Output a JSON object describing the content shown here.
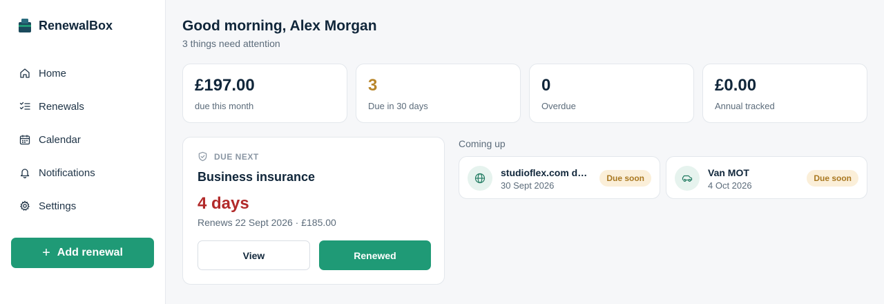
{
  "app": {
    "name": "RenewalBox"
  },
  "sidebar": {
    "items": [
      {
        "label": "Home",
        "icon": "home-icon"
      },
      {
        "label": "Renewals",
        "icon": "checklist-icon"
      },
      {
        "label": "Calendar",
        "icon": "calendar-icon"
      },
      {
        "label": "Notifications",
        "icon": "bell-icon"
      },
      {
        "label": "Settings",
        "icon": "gear-icon"
      }
    ],
    "add_button": {
      "label": "Add renewal",
      "plus": "+"
    }
  },
  "header": {
    "greeting": "Good morning, Alex Morgan",
    "subtitle": "3 things need attention"
  },
  "stats": [
    {
      "value": "£197.00",
      "label": "due this month"
    },
    {
      "value": "3",
      "label": "Due in 30 days",
      "color": "#b8862b"
    },
    {
      "value": "0",
      "label": "Overdue"
    },
    {
      "value": "£0.00",
      "label": "Annual tracked"
    }
  ],
  "due_next": {
    "tag": "DUE NEXT",
    "title": "Business insurance",
    "days": "4 days",
    "renews": "Renews 22 Sept 2026 · £185.00",
    "view_label": "View",
    "renewed_label": "Renewed"
  },
  "coming_up": {
    "title": "Coming up",
    "items": [
      {
        "name": "studioflex.com domain",
        "date": "30 Sept 2026",
        "badge": "Due soon",
        "icon": "globe-icon"
      },
      {
        "name": "Van MOT",
        "date": "4 Oct 2026",
        "badge": "Due soon",
        "icon": "car-icon"
      }
    ]
  },
  "colors": {
    "accent": "#1f9a76",
    "danger": "#b22a2a",
    "warning": "#b8862b",
    "badge_bg": "#fbefd9"
  }
}
